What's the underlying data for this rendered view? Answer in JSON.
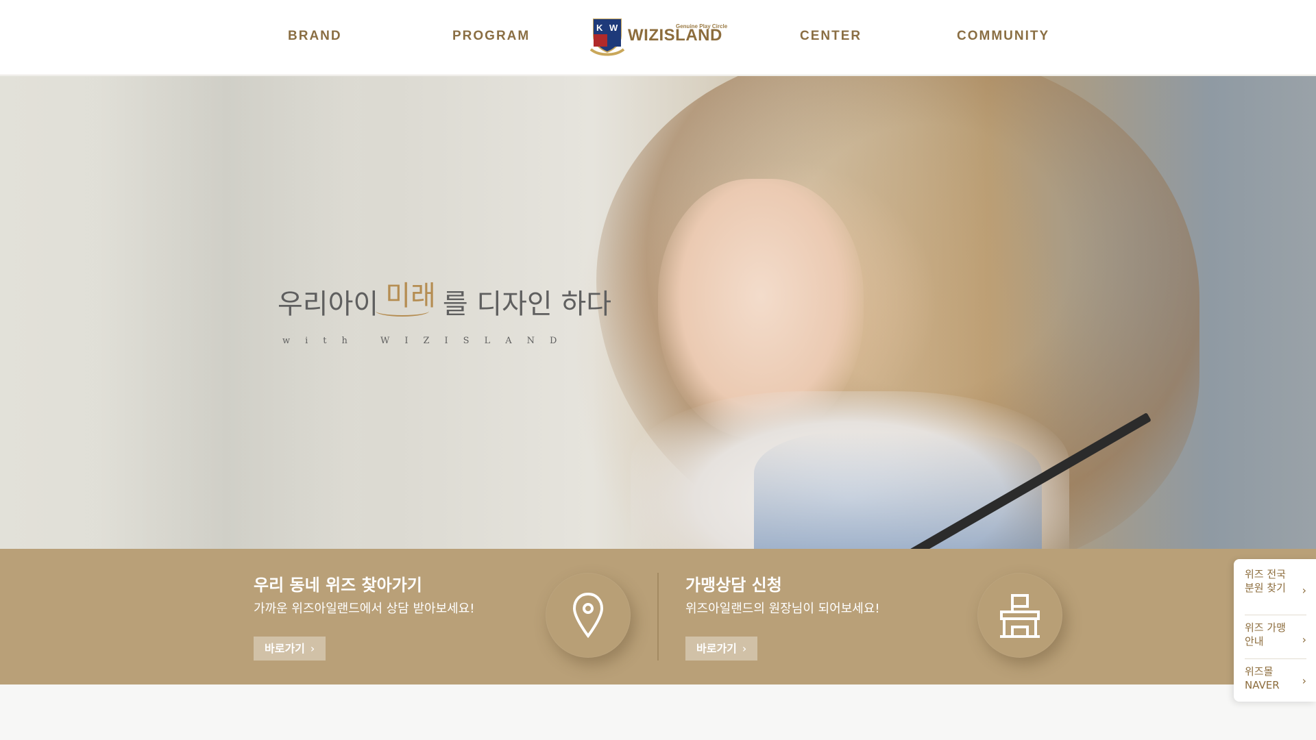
{
  "header": {
    "nav": [
      "BRAND",
      "PROGRAM",
      "CENTER",
      "COMMUNITY"
    ],
    "logo": {
      "tagline": "Genuine Play Circle",
      "name": "WIZISLAND",
      "crest_letters": [
        "K",
        "W"
      ]
    }
  },
  "hero": {
    "title_before": "우리아이",
    "title_accent": "미래",
    "title_after": "를 디자인 하다",
    "subtitle": "with WIZISLAND"
  },
  "cards": [
    {
      "title": "우리 동네 위즈 찾아가기",
      "desc": "가까운 위즈아일랜드에서 상담 받아보세요!",
      "button": "바로가기",
      "icon": "location-pin-icon"
    },
    {
      "title": "가맹상담 신청",
      "desc": "위즈아일랜드의 원장님이 되어보세요!",
      "button": "바로가기",
      "icon": "building-flag-icon"
    }
  ],
  "quick_menu": [
    {
      "label": "위즈 전국분원 찾기"
    },
    {
      "label": "위즈 가맹안내"
    },
    {
      "label": "위즈몰 NAVER"
    }
  ],
  "colors": {
    "brand": "#8c6c3c",
    "accent": "#b58d52",
    "band": "#b9a078"
  }
}
